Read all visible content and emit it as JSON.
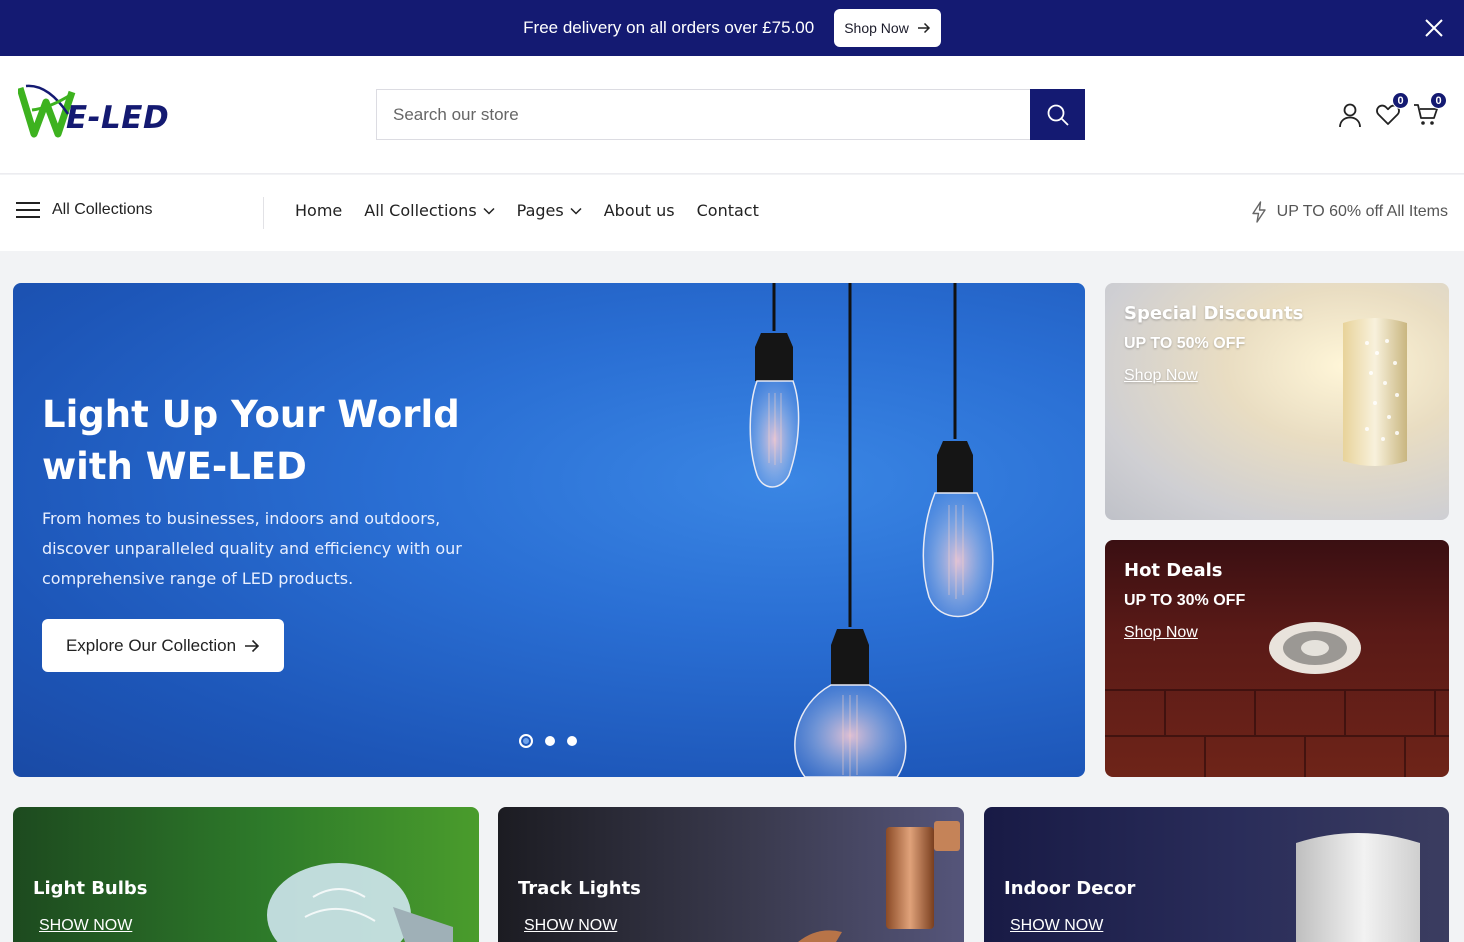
{
  "colors": {
    "brand_navy": "#141a72",
    "brand_green": "#3db21f",
    "hero_blue": "#2a6fd4"
  },
  "announcement": {
    "text": "Free delivery on all orders over £75.00",
    "button_label": "Shop Now",
    "close_icon": "close-icon"
  },
  "header": {
    "logo_text": "E-LED",
    "search_placeholder": "Search our store",
    "wishlist_count": "0",
    "cart_count": "0",
    "icons": [
      "search-icon",
      "user-icon",
      "heart-icon",
      "cart-icon"
    ]
  },
  "nav": {
    "all_collections": "All Collections",
    "links": [
      {
        "label": "Home",
        "dropdown": false
      },
      {
        "label": "All Collections",
        "dropdown": true
      },
      {
        "label": "Pages",
        "dropdown": true
      },
      {
        "label": "About us",
        "dropdown": false
      },
      {
        "label": "Contact",
        "dropdown": false
      }
    ],
    "promo_text": "UP TO 60% off All Items"
  },
  "hero": {
    "title": "Light Up Your World with WE-LED",
    "subtitle": "From homes to businesses, indoors and outdoors, discover unparalleled quality and efficiency with our comprehensive range of LED products.",
    "button_label": "Explore Our Collection",
    "slides": 3,
    "active_slide": 1
  },
  "promos": [
    {
      "title": "Special Discounts",
      "subtitle": "UP TO 50% OFF",
      "link": "Shop Now"
    },
    {
      "title": "Hot Deals",
      "subtitle": "UP TO 30% OFF",
      "link": "Shop Now"
    }
  ],
  "categories": [
    {
      "title": "Light Bulbs",
      "link": "SHOW NOW"
    },
    {
      "title": "Track Lights",
      "link": "SHOW NOW"
    },
    {
      "title": "Indoor Decor",
      "link": "SHOW NOW"
    }
  ]
}
